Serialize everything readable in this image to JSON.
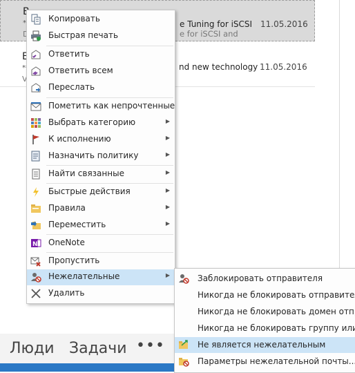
{
  "mail": {
    "rows": [
      {
        "sender": "B",
        "stars": "**",
        "snippet": "D",
        "subject": "e Tuning for iSCSI",
        "preview": "e for iSCSI and",
        "date": "11.05.2016"
      },
      {
        "sender": "E",
        "stars": "**",
        "snippet": "V",
        "subject": "nd new technology",
        "preview": "",
        "date": "11.05.2016"
      }
    ]
  },
  "context_menu": {
    "items": [
      {
        "label": "Копировать",
        "icon": "copy-icon"
      },
      {
        "label": "Быстрая печать",
        "icon": "print-icon"
      },
      {
        "label": "Ответить",
        "icon": "reply-icon"
      },
      {
        "label": "Ответить всем",
        "icon": "reply-all-icon"
      },
      {
        "label": "Переслать",
        "icon": "forward-icon"
      },
      {
        "label": "Пометить как непрочтенные",
        "icon": "mark-unread-icon"
      },
      {
        "label": "Выбрать категорию",
        "icon": "category-icon"
      },
      {
        "label": "К исполнению",
        "icon": "flag-icon"
      },
      {
        "label": "Назначить политику",
        "icon": "policy-icon"
      },
      {
        "label": "Найти связанные",
        "icon": "find-related-icon"
      },
      {
        "label": "Быстрые действия",
        "icon": "quick-steps-icon"
      },
      {
        "label": "Правила",
        "icon": "rules-icon"
      },
      {
        "label": "Переместить",
        "icon": "move-icon"
      },
      {
        "label": "OneNote",
        "icon": "onenote-icon"
      },
      {
        "label": "Пропустить",
        "icon": "ignore-icon"
      },
      {
        "label": "Нежелательные",
        "icon": "junk-icon"
      },
      {
        "label": "Удалить",
        "icon": "delete-icon"
      }
    ]
  },
  "junk_submenu": {
    "items": [
      {
        "label": "Заблокировать отправителя",
        "icon": "block-sender-icon"
      },
      {
        "label": "Никогда не блокировать отправителя"
      },
      {
        "label": "Никогда не блокировать домен отправите"
      },
      {
        "label": "Никогда не блокировать группу или спис"
      },
      {
        "label": "Не является нежелательным",
        "icon": "not-junk-icon"
      },
      {
        "label": "Параметры нежелательной почты...",
        "icon": "junk-options-icon"
      }
    ]
  },
  "bottom_nav": {
    "people": "Люди",
    "tasks": "Задачи",
    "more": "•••"
  },
  "colors": {
    "highlight": "#cce4f7",
    "status_bar": "#2b78c5"
  }
}
